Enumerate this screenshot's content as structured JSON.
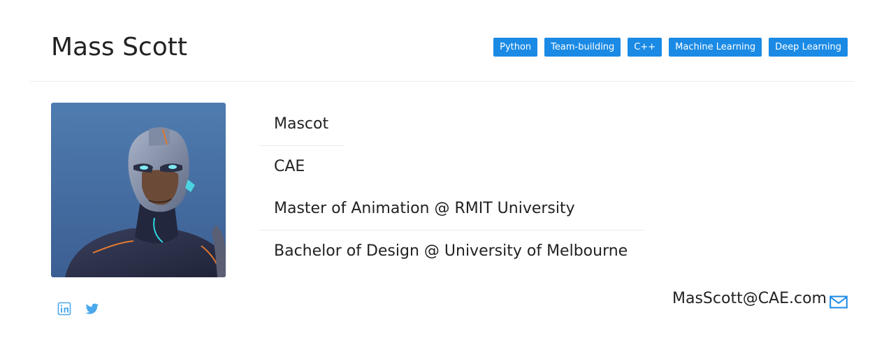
{
  "profile": {
    "name": "Mass Scott",
    "skills": [
      "Python",
      "Team-building",
      "C++",
      "Machine Learning",
      "Deep Learning"
    ],
    "details": {
      "nickname": "Mascot",
      "company": "CAE",
      "education_1": "Master of Animation @ RMIT University",
      "education_2": "Bachelor of Design @ University of Melbourne"
    },
    "email": "MasScott@CAE.com"
  },
  "icons": {
    "linkedin": "linkedin-icon",
    "twitter": "twitter-icon",
    "email": "mail-icon"
  },
  "colors": {
    "badge_bg": "#1a8ae5",
    "badge_text": "#ffffff",
    "social_icon": "#4aa8ec",
    "mail_icon": "#1a8ae5",
    "avatar_bg": "#4a6fa5"
  }
}
